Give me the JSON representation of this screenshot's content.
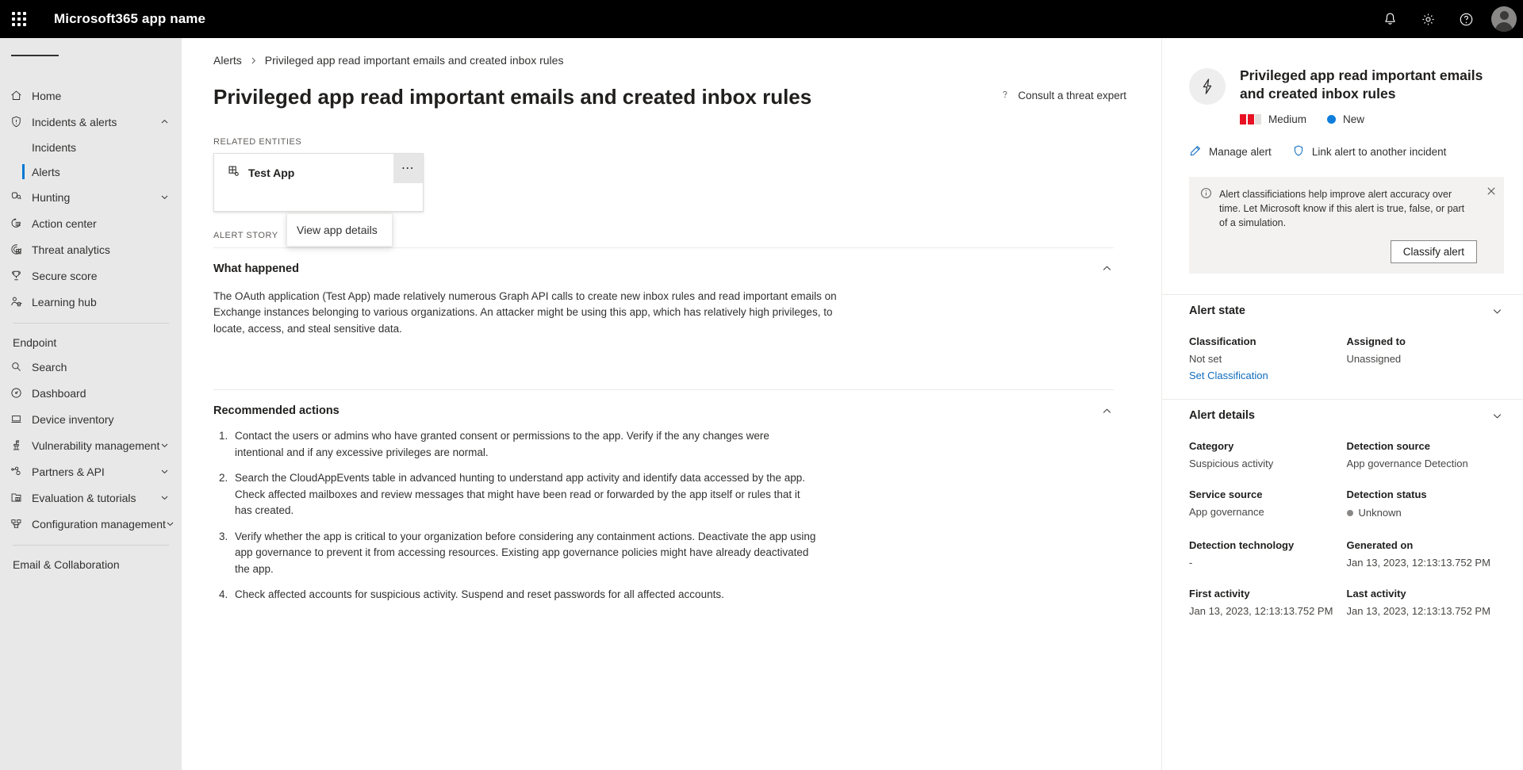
{
  "suitebar": {
    "waffle_icon": "app-launcher-icon",
    "title": "Microsoft365 app name",
    "notifications_icon": "bell-icon",
    "settings_icon": "gear-icon",
    "help_icon": "question-icon",
    "avatar_icon": "user-avatar"
  },
  "nav": {
    "hamburger_icon": "hamburger-icon",
    "items": [
      {
        "label": "Home",
        "icon": "home-icon",
        "expandable": false
      },
      {
        "label": "Incidents & alerts",
        "icon": "shield-icon",
        "expandable": true,
        "expanded": true
      },
      {
        "label": "Hunting",
        "icon": "hunting-icon",
        "expandable": true,
        "expanded": false
      },
      {
        "label": "Action center",
        "icon": "action-center-icon",
        "expandable": false
      },
      {
        "label": "Threat analytics",
        "icon": "threat-analytics-icon",
        "expandable": false
      },
      {
        "label": "Secure score",
        "icon": "trophy-icon",
        "expandable": false
      },
      {
        "label": "Learning hub",
        "icon": "learning-hub-icon",
        "expandable": false
      }
    ],
    "sub_items": [
      {
        "label": "Incidents",
        "selected": false
      },
      {
        "label": "Alerts",
        "selected": true
      }
    ],
    "group_label": "Endpoint",
    "endpoint_items": [
      {
        "label": "Search",
        "icon": "search-icon",
        "expandable": false
      },
      {
        "label": "Dashboard",
        "icon": "dashboard-icon",
        "expandable": false
      },
      {
        "label": "Device inventory",
        "icon": "device-icon",
        "expandable": false
      },
      {
        "label": "Vulnerability management",
        "icon": "vulnerability-icon",
        "expandable": true
      },
      {
        "label": "Partners & API",
        "icon": "partners-icon",
        "expandable": true
      },
      {
        "label": "Evaluation & tutorials",
        "icon": "evaluation-icon",
        "expandable": true
      },
      {
        "label": "Configuration management",
        "icon": "configuration-icon",
        "expandable": true
      }
    ],
    "group_label_2": "Email & Collaboration"
  },
  "breadcrumb": {
    "parent": "Alerts",
    "separator_icon": "chevron-right-icon",
    "current": "Privileged app read important emails and created inbox rules"
  },
  "header": {
    "title": "Privileged app read important emails and created inbox rules",
    "consult_icon": "question-icon",
    "consult_label": "Consult a threat expert"
  },
  "related_entities": {
    "label": "RELATED ENTITIES",
    "entity_icon": "app-grid-icon",
    "entity_name": "Test App",
    "more_icon": "ellipsis-icon",
    "menu": {
      "items": [
        {
          "label": "View app details"
        }
      ]
    }
  },
  "alert_story": {
    "label": "ALERT STORY",
    "what_happened": {
      "title": "What happened",
      "chevron_icon": "chevron-up-icon",
      "body": "The OAuth application (Test App) made relatively numerous Graph API calls to create new inbox rules and read important emails on Exchange instances belonging to various organizations. An attacker might be using this app, which has relatively high privileges, to locate, access, and steal sensitive data."
    },
    "recommended_actions": {
      "title": "Recommended actions",
      "chevron_icon": "chevron-up-icon",
      "items": [
        "Contact the users or admins who have granted consent or permissions to the app. Verify if the any changes were intentional and if any excessive privileges are normal.",
        "Search the CloudAppEvents table in advanced hunting to understand app activity and identify data accessed by the app. Check affected mailboxes and review messages that might have been read or forwarded by the app itself or rules that it has created.",
        "Verify whether the app is critical to your organization before considering any containment actions. Deactivate the app using app governance to prevent it from accessing resources. Existing app governance policies might have already deactivated the app.",
        "Check affected accounts for suspicious activity. Suspend and reset passwords for all affected accounts."
      ]
    }
  },
  "details_pane": {
    "bolt_icon": "lightning-bolt-icon",
    "title": "Privileged app read important emails and created inbox rules",
    "severity": {
      "label": "Medium",
      "color": "#e81123",
      "filled_bars": 2,
      "total_bars": 3
    },
    "status": {
      "label": "New",
      "color": "#0f7ddb"
    },
    "actions": [
      {
        "label": "Manage alert",
        "icon": "pencil-icon"
      },
      {
        "label": "Link alert to another incident",
        "icon": "shield-icon"
      }
    ],
    "info_banner": {
      "icon": "info-icon",
      "text": "Alert classificiations help improve alert accuracy over time. Let Microsoft know if this alert is true, false, or part of a simulation.",
      "close_icon": "close-icon",
      "button_label": "Classify alert"
    },
    "alert_state": {
      "title": "Alert state",
      "chevron_icon": "chevron-down-icon",
      "fields": [
        {
          "label": "Classification",
          "value": "Not set",
          "link": "Set Classification"
        },
        {
          "label": "Assigned to",
          "value": "Unassigned"
        }
      ]
    },
    "alert_details": {
      "title": "Alert details",
      "chevron_icon": "chevron-down-icon",
      "fields": [
        {
          "label": "Category",
          "value": "Suspicious activity"
        },
        {
          "label": "Detection source",
          "value": "App governance Detection"
        },
        {
          "label": "Service source",
          "value": "App governance"
        },
        {
          "label": "Detection status",
          "value": "Unknown",
          "dot_color": "#8a8886"
        },
        {
          "label": "Detection technology",
          "value": "-"
        },
        {
          "label": "Generated on",
          "value": "Jan 13, 2023, 12:13:13.752 PM"
        },
        {
          "label": "First activity",
          "value": "Jan 13, 2023, 12:13:13.752 PM"
        },
        {
          "label": "Last activity",
          "value": "Jan 13, 2023, 12:13:13.752 PM"
        }
      ]
    }
  }
}
